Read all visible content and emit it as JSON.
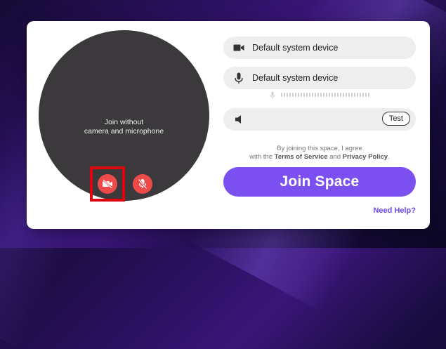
{
  "preview": {
    "message_line1": "Join without",
    "message_line2": "camera and microphone",
    "camera_toggle_icon": "camera-off-icon",
    "mic_toggle_icon": "mic-off-icon",
    "toggle_color": "#ef4a4a"
  },
  "devices": {
    "camera": {
      "icon": "video-camera-icon",
      "value": "Default system device"
    },
    "microphone": {
      "icon": "microphone-icon",
      "value": "Default system device",
      "level": 0
    },
    "speaker": {
      "icon": "speaker-icon",
      "value": "",
      "test_label": "Test"
    }
  },
  "terms": {
    "line1": "By joining this space, I agree",
    "prefix": "with the ",
    "tos": "Terms of Service",
    "and": " and ",
    "privacy": "Privacy Policy",
    "suffix": "."
  },
  "join_button": {
    "label": "Join Space",
    "color": "#7b4ff0"
  },
  "help_link": {
    "label": "Need Help?"
  },
  "highlight_color": "#e3000f"
}
